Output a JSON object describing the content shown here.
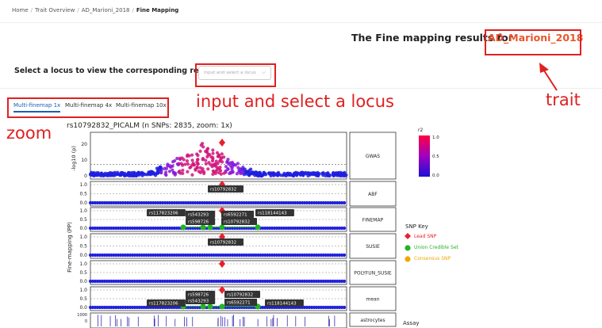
{
  "breadcrumb": [
    "Home",
    "Trait Overview",
    "AD_Marioni_2018",
    "Fine Mapping"
  ],
  "header": {
    "prefix": "The Fine mapping results for",
    "trait": "AD_Marioni_2018"
  },
  "locus": {
    "label": "Select a locus to view the corresponding results:",
    "placeholder": "Input and select a locus"
  },
  "tabs": [
    "Multi-finemap 1x",
    "Multi-finemap 4x",
    "Multi-finemap 10x"
  ],
  "annotations": {
    "input": "input and select a locus",
    "trait": "trait",
    "zoom": "zoom"
  },
  "plot": {
    "title": "rs10792832_PICALM   (n SNPs: 2835, zoom: 1x)",
    "gwas_ylabel": "-log10 (p)",
    "fm_ylabel": "Fine-mapping (PP)",
    "gwas_ticks": [
      "20",
      "10",
      "0"
    ],
    "pp_ticks": [
      "1.0",
      "0.5",
      "0.0"
    ],
    "track_ticks": [
      "1000",
      "0"
    ],
    "panels": [
      "GWAS",
      "ABF",
      "FINEMAP",
      "SUSIE",
      "POLYFUN_SUSIE",
      "mean",
      "astrocytes"
    ],
    "colorbar": {
      "label": "r2",
      "ticks": [
        "1.0",
        "0.5",
        "0.0"
      ]
    },
    "snp_labels": {
      "abf": [
        "rs10792832"
      ],
      "finemap": [
        "rs117823206",
        "rs543293",
        "rs598726",
        "rs6592271",
        "rs10792832",
        "rs118144143"
      ],
      "susie": [
        "rs10792832"
      ],
      "mean": [
        "rs598726",
        "rs543293",
        "rs117823206",
        "rs10792832",
        "rs6592271",
        "rs118144143"
      ]
    }
  },
  "snp_key": {
    "title": "SNP Key",
    "items": [
      {
        "label": "Lead SNP",
        "color": "#e8202a"
      },
      {
        "label": "Union Credible Set",
        "color": "#22b522"
      },
      {
        "label": "Consensus SNP",
        "color": "#f2a600"
      }
    ]
  },
  "assay": "Assay",
  "colors": {
    "accent": "#1a5fb4",
    "trait": "#e8562e",
    "annotation": "#e02020"
  }
}
